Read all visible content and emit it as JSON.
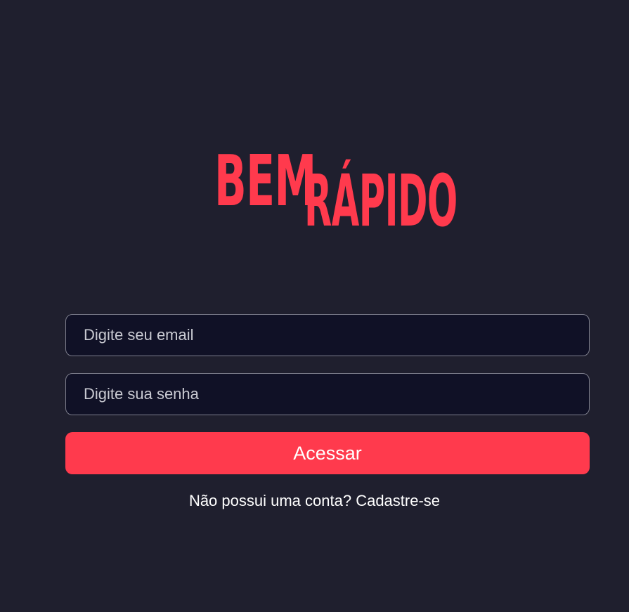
{
  "brand": {
    "logo_line1": "BEM",
    "logo_line2": "RÁPIDO",
    "accent_color": "#ff3a4d"
  },
  "login_form": {
    "email_placeholder": "Digite seu email",
    "password_placeholder": "Digite sua senha",
    "submit_label": "Acessar"
  },
  "signup": {
    "prompt": "Não possui uma conta? ",
    "link_label": "Cadastre-se"
  },
  "colors": {
    "background": "#1f1f2e",
    "input_background": "#101126",
    "input_border": "#7d7e8c",
    "text": "#ffffff"
  }
}
